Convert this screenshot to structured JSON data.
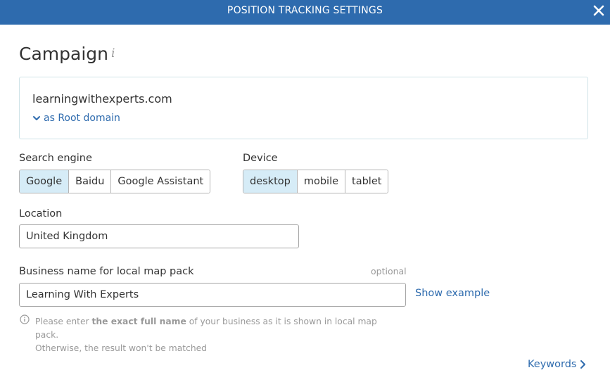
{
  "dialog": {
    "title": "POSITION TRACKING SETTINGS",
    "close_icon": "close-icon"
  },
  "campaign": {
    "heading": "Campaign",
    "info_icon_glyph": "i",
    "domain": "learningwithexperts.com",
    "domain_scope": "as Root domain"
  },
  "search_engine": {
    "label": "Search engine",
    "options": [
      "Google",
      "Baidu",
      "Google Assistant"
    ],
    "selected": "Google"
  },
  "device": {
    "label": "Device",
    "options": [
      "desktop",
      "mobile",
      "tablet"
    ],
    "selected": "desktop"
  },
  "location": {
    "label": "Location",
    "value": "United Kingdom"
  },
  "business": {
    "label": "Business name for local map pack",
    "optional_label": "optional",
    "value": "Learning With Experts",
    "show_example": "Show example",
    "hint_prefix": "Please enter ",
    "hint_bold": "the exact full name",
    "hint_suffix": " of your business as it is shown in local map pack.",
    "hint_line2": "Otherwise, the result won't be matched"
  },
  "footer": {
    "next_label": "Keywords"
  },
  "colors": {
    "header_bg": "#2e6bae",
    "accent": "#2e6bae",
    "selected_bg": "#d6ecf7"
  }
}
